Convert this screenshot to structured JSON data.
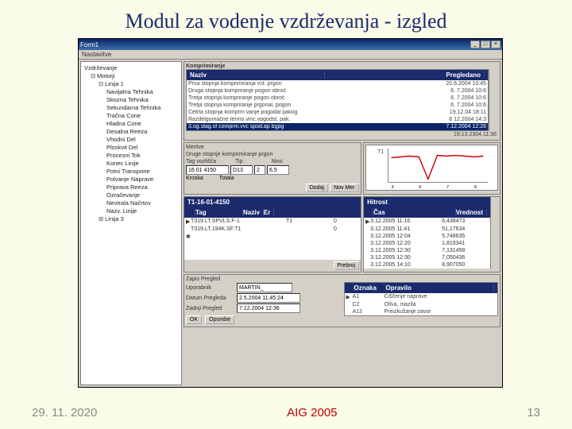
{
  "slide": {
    "title": "Modul za vodenje vzdrževanja - izgled"
  },
  "footer": {
    "date": "29. 11. 2020",
    "center": "AIG 2005",
    "page": "13"
  },
  "window": {
    "title": "Form1",
    "menu": "Nastavitve",
    "win_btns": {
      "min": "_",
      "max": "□",
      "close": "×"
    }
  },
  "tree": {
    "root": "Vzdrževanje",
    "n1": "Motorji",
    "n2": "Linija 1",
    "items": [
      "Navijalna Tehnika",
      "Skozna Tehnika",
      "Sekundarna Tehnika",
      "Tračna Cone",
      "Hladna Cone",
      "Desalna Reeza",
      "Vhodni Del",
      "Ploskvit Del",
      "Procesni Tok",
      "Konec Linije",
      "Potni Transpone",
      "Polvanje Naprave",
      "Priprava Reeza",
      "Ozračevanje",
      "Nevtrala Načrtov",
      "Nazv. Linije"
    ],
    "n3": "Linija 3"
  },
  "top_grid": {
    "title": "Komprimiranje",
    "col1": "Naziv",
    "col2": "Pregledano",
    "rows": [
      {
        "a": "Prva stopnja komprimiranja vst. prgon",
        "b": "20.6.2004 10:45"
      },
      {
        "a": "Druga stopnja kompriranje pogon obroč",
        "b": "6. 7.2004 10:6"
      },
      {
        "a": "Tretja stopnja kompriranje pogon obroč",
        "b": "6. 7.2004 10:6"
      },
      {
        "a": "Tretja stopnja kompriranje prgonal, pogon",
        "b": "6. 7.2004 10:6"
      },
      {
        "a": "Četrta stopnja komprm vanje pogodal pakog",
        "b": "19.12.04 18:11"
      },
      {
        "a": "Razdelgomačne termo.vinc.vpgodst, pak.",
        "b": "6 12.2004 14:3"
      },
      {
        "a": "3.og.stag.sf comprm.vvc spod.ap bgpg",
        "b": "7.12.2004 12:26"
      }
    ],
    "status": "19:13.2304.11:36"
  },
  "merit": {
    "label": "Meritve",
    "desc": "Druge stopnje komprimiranje prgon",
    "tag_l": "Tag vozlišča",
    "tag_v": "16 01 4150",
    "tip_l": "Tip",
    "tip_v": "D13",
    "q_v": "2",
    "n_l": "Nivo",
    "n_v": "6,5",
    "kroska": "Kroska",
    "totala": "Totala",
    "btn1": "Dodaj",
    "btn2": "Nov Mer"
  },
  "chart": {
    "label": "T1",
    "ticks": [
      "3",
      "5",
      "7",
      "9"
    ],
    "series": [
      38,
      40,
      41,
      40,
      18,
      42,
      41,
      42,
      41,
      40,
      41
    ]
  },
  "tags": {
    "title": "T1-16-01-4150",
    "c1": "Tag",
    "c2": "Naziv",
    "c3": "Er",
    "rows": [
      {
        "p": "▶",
        "a": "T319.LT.SPVLS.F-1",
        "b": "T1",
        "c": "0"
      },
      {
        "p": "",
        "a": "T319.LT.194K.SF.T1",
        "b": "",
        "c": "0"
      },
      {
        "p": "✱",
        "a": "",
        "b": "",
        "c": ""
      }
    ],
    "btn": "Prebroj"
  },
  "hitrost": {
    "title": "Hitrost",
    "c1": "Čas",
    "c2": "Vrednost",
    "rows": [
      {
        "p": "▶",
        "a": "3.12.2005 11:16",
        "b": "6,438473"
      },
      {
        "p": "",
        "a": "3.12.2005 11:41",
        "b": "51,17634"
      },
      {
        "p": "",
        "a": "3.12.2005 12:04",
        "b": "5,748635"
      },
      {
        "p": "",
        "a": "3.12.2005 12:20",
        "b": "1,819341"
      },
      {
        "p": "",
        "a": "3.12.2005 12:30",
        "b": "7,131458"
      },
      {
        "p": "",
        "a": "3.12.2005 12:30",
        "b": "7,050436"
      },
      {
        "p": "",
        "a": "3.12.2005 14:10",
        "b": "8,907050"
      }
    ]
  },
  "bottom": {
    "title": "Zapis Pregled",
    "uporabnik_l": "Uporabnik",
    "uporabnik_v": "MARTIN_",
    "datum_l": "Datum Pregleda",
    "datum_v": "2.5.2004 11:45:24",
    "zadnji_l": "Zadnji Pregled",
    "zadnji_v": "7.12.2004 12:36",
    "btn_ok": "OK",
    "btn_op": "Opombe",
    "gcol1": "Oznaka",
    "gcol2": "Opravilo",
    "rows": [
      {
        "p": "▶",
        "a": "A1",
        "b": "Čiščenje naprave"
      },
      {
        "p": "",
        "a": "C2",
        "b": "Oliva, mazila"
      },
      {
        "p": "",
        "a": "A13",
        "b": "Preizkušanje zavor"
      }
    ]
  }
}
